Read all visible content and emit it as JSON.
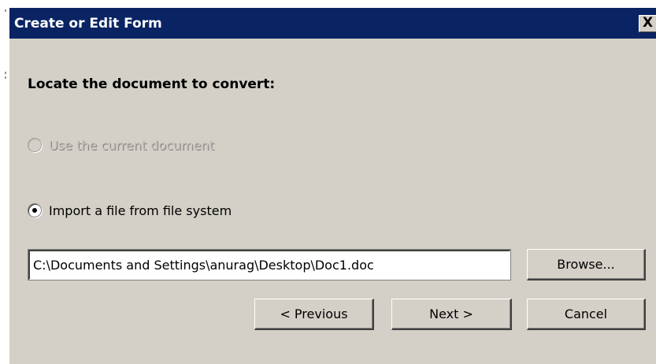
{
  "window": {
    "title": "Create or Edit Form",
    "close_glyph": "X"
  },
  "main": {
    "heading": "Locate the document to convert:",
    "options": [
      {
        "label": "Use the current document",
        "selected": false,
        "enabled": false
      },
      {
        "label": "Import a file from file system",
        "selected": true,
        "enabled": true
      }
    ],
    "file_path": "C:\\Documents and Settings\\anurag\\Desktop\\Doc1.doc"
  },
  "buttons": {
    "browse": "Browse...",
    "previous": "< Previous",
    "next": "Next >",
    "cancel": "Cancel"
  },
  "colors": {
    "titlebar": "#0a2463",
    "dialog_face": "#d4d0c8"
  }
}
